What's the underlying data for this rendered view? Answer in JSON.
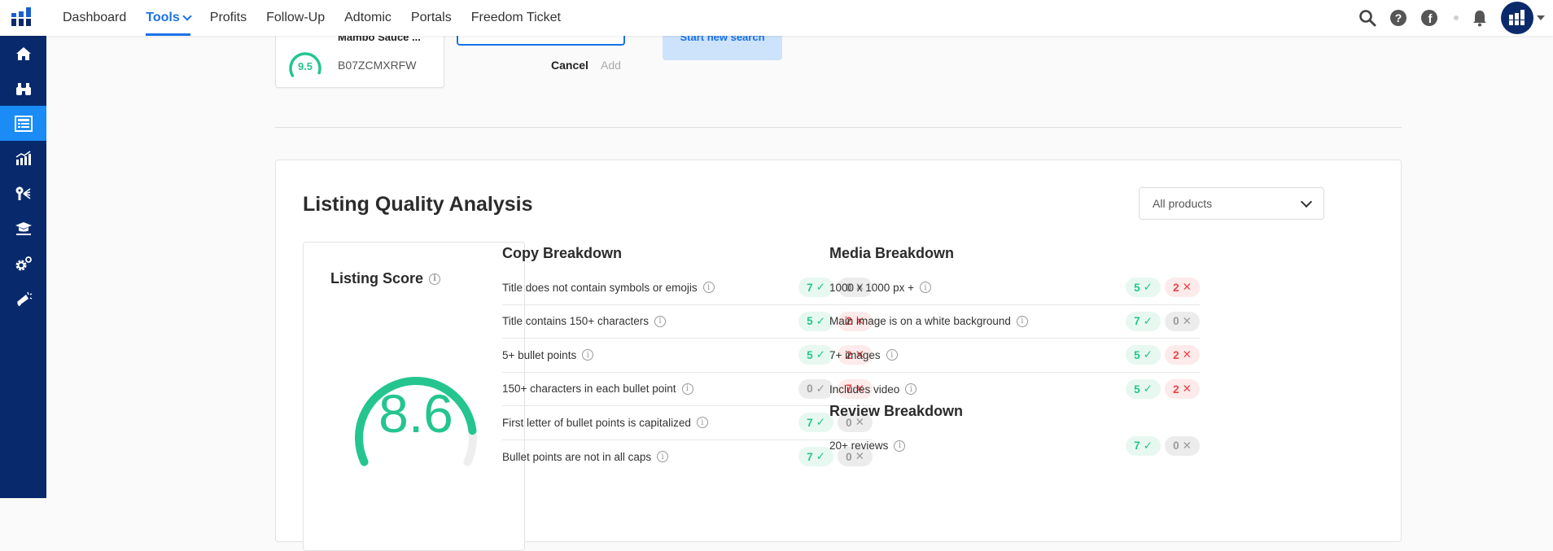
{
  "nav": {
    "items": [
      {
        "label": "Dashboard",
        "active": false
      },
      {
        "label": "Tools",
        "active": true,
        "has_dropdown": true
      },
      {
        "label": "Profits",
        "active": false
      },
      {
        "label": "Follow-Up",
        "active": false
      },
      {
        "label": "Adtomic",
        "active": false
      },
      {
        "label": "Portals",
        "active": false
      },
      {
        "label": "Freedom Ticket",
        "active": false
      }
    ],
    "right_icons": [
      "search-icon",
      "help-icon",
      "facebook-icon",
      "bell-icon",
      "avatar"
    ]
  },
  "sidebar": {
    "items": [
      {
        "icon": "home-icon",
        "active": false
      },
      {
        "icon": "binoculars-icon",
        "active": false
      },
      {
        "icon": "listing-icon",
        "active": true
      },
      {
        "icon": "chart-icon",
        "active": false
      },
      {
        "icon": "keyword-icon",
        "active": false
      },
      {
        "icon": "academy-icon",
        "active": false
      },
      {
        "icon": "settings-icon",
        "active": false
      },
      {
        "icon": "megaphone-icon",
        "active": false
      }
    ]
  },
  "product_card": {
    "name": "Mambo Sauce ...",
    "asin": "B07ZCMXRFW",
    "score": "9.5"
  },
  "search": {
    "value": "",
    "cancel_label": "Cancel",
    "add_label": "Add",
    "start_label": "Start new search"
  },
  "analysis": {
    "title": "Listing Quality Analysis",
    "filter": {
      "selected": "All products"
    },
    "listing_score": {
      "label": "Listing Score",
      "value": "8.6",
      "max": 10
    },
    "copy": {
      "title": "Copy Breakdown",
      "rows": [
        {
          "label": "Title does not contain symbols or emojis",
          "pass": "7",
          "fail": "0"
        },
        {
          "label": "Title contains 150+ characters",
          "pass": "5",
          "fail": "2"
        },
        {
          "label": "5+ bullet points",
          "pass": "5",
          "fail": "2"
        },
        {
          "label": "150+ characters in each bullet point",
          "pass": "0",
          "fail": "7"
        },
        {
          "label": "First letter of bullet points is capitalized",
          "pass": "7",
          "fail": "0"
        },
        {
          "label": "Bullet points are not in all caps",
          "pass": "7",
          "fail": "0"
        }
      ]
    },
    "media": {
      "title": "Media Breakdown",
      "rows": [
        {
          "label": "1000 x 1000 px +",
          "pass": "5",
          "fail": "2"
        },
        {
          "label": "Main image is on a white background",
          "pass": "7",
          "fail": "0"
        },
        {
          "label": "7+ images",
          "pass": "5",
          "fail": "2"
        },
        {
          "label": "Includes video",
          "pass": "5",
          "fail": "2"
        }
      ]
    },
    "review": {
      "title": "Review Breakdown",
      "rows": [
        {
          "label": "20+ reviews",
          "pass": "7",
          "fail": "0"
        }
      ]
    }
  },
  "colors": {
    "accent": "#1a73e8",
    "sidebar": "#082a6d",
    "sidebar_active": "#1b8cf5",
    "good": "#24c58f",
    "bad": "#e84545"
  }
}
